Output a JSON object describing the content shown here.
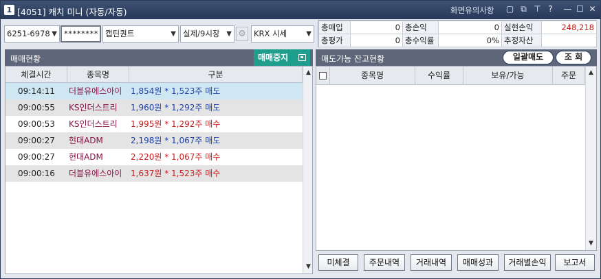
{
  "titlebar": {
    "number": "1",
    "title": "[4051] 캐치 미니 (자동/자동)",
    "notice": "화면유의사항"
  },
  "controls": {
    "account": "6251-6978",
    "password": "********",
    "strategy": "캡틴퀀트",
    "mode": "실제/9시장",
    "market": "KRX 시세"
  },
  "summary": {
    "row1": [
      {
        "label": "총매입",
        "value": "0"
      },
      {
        "label": "총손익",
        "value": "0"
      },
      {
        "label": "실현손익",
        "value": "248,218"
      }
    ],
    "row2": [
      {
        "label": "총평가",
        "value": "0"
      },
      {
        "label": "총수익률",
        "value": "0%"
      },
      {
        "label": "추정자산",
        "value": ""
      }
    ]
  },
  "trade_panel": {
    "title": "매매현황",
    "stop_button": "매매중지",
    "columns": [
      "체결시간",
      "종목명",
      "구분"
    ],
    "rows": [
      {
        "time": "09:14:11",
        "name": "더블유에스아이",
        "detail": "1,854원 * 1,523주 매도",
        "side": "sell"
      },
      {
        "time": "09:00:55",
        "name": "KS인더스트리",
        "detail": "1,960원 * 1,292주 매도",
        "side": "sell"
      },
      {
        "time": "09:00:53",
        "name": "KS인더스트리",
        "detail": "1,995원 * 1,292주 매수",
        "side": "buy"
      },
      {
        "time": "09:00:27",
        "name": "현대ADM",
        "detail": "2,198원 * 1,067주 매도",
        "side": "sell"
      },
      {
        "time": "09:00:27",
        "name": "현대ADM",
        "detail": "2,220원 * 1,067주 매수",
        "side": "buy"
      },
      {
        "time": "09:00:16",
        "name": "더블유에스아이",
        "detail": "1,637원 * 1,523주 매수",
        "side": "buy"
      }
    ]
  },
  "balance_panel": {
    "title": "매도가능 잔고현황",
    "sell_all_button": "일괄매도",
    "query_button": "조 회",
    "columns": [
      "종목명",
      "수익률",
      "보유/가능",
      "주문"
    ]
  },
  "bottom_buttons": [
    "미체결",
    "주문내역",
    "거래내역",
    "매매성과",
    "거래별손익",
    "보고서"
  ],
  "colors": {
    "titlebar": "#27385a",
    "panel_header": "#5d6779",
    "stop_button": "#1f9e8d",
    "sell": "#1c3fa8",
    "buy": "#c81b1b",
    "profit": "#c01d1d",
    "selected_row": "#cfe7f3"
  }
}
